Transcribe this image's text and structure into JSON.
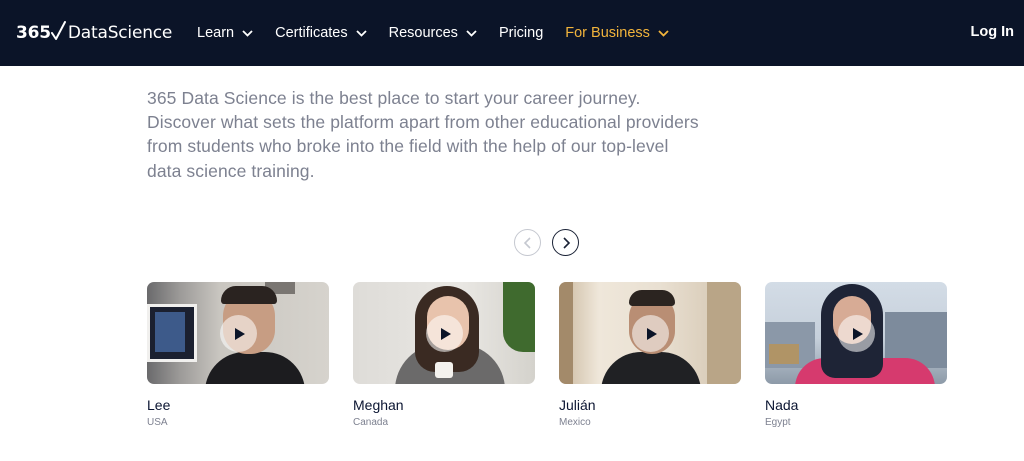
{
  "nav": {
    "logo": {
      "number": "365",
      "brand_a": "Data",
      "brand_b": "Science"
    },
    "items": [
      {
        "label": "Learn",
        "has_dropdown": true
      },
      {
        "label": "Certificates",
        "has_dropdown": true
      },
      {
        "label": "Resources",
        "has_dropdown": true
      },
      {
        "label": "Pricing",
        "has_dropdown": false
      },
      {
        "label": "For Business",
        "has_dropdown": true
      }
    ],
    "login": "Log In",
    "colors": {
      "background": "#0b1428",
      "business_accent": "#f2b43c"
    }
  },
  "intro": {
    "text": "365 Data Science is the best place to start your career journey. Discover what sets the platform apart from other educational providers from students who broke into the field with the help of our top-level data science training."
  },
  "carousel": {
    "prev_icon": "chevron-left-icon",
    "next_icon": "chevron-right-icon",
    "cards": [
      {
        "name": "Lee",
        "country": "USA"
      },
      {
        "name": "Meghan",
        "country": "Canada"
      },
      {
        "name": "Julián",
        "country": "Mexico"
      },
      {
        "name": "Nada",
        "country": "Egypt"
      }
    ]
  }
}
